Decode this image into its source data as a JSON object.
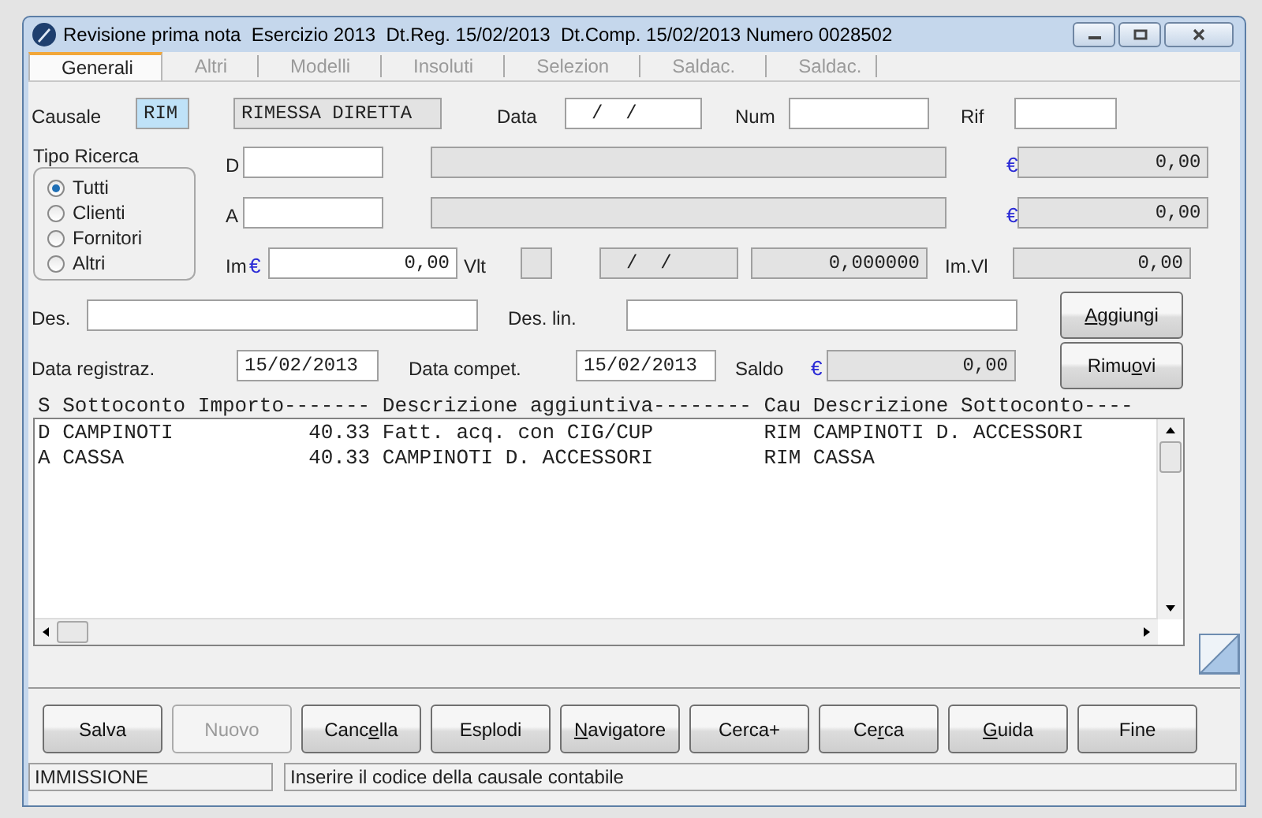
{
  "window": {
    "title": "Revisione prima nota  Esercizio 2013  Dt.Reg. 15/02/2013  Dt.Comp. 15/02/2013 Numero 0028502"
  },
  "tabs": [
    {
      "label": "Generali",
      "selected": true
    },
    {
      "label": "Altri",
      "selected": false
    },
    {
      "label": "Modelli",
      "selected": false
    },
    {
      "label": "Insoluti",
      "selected": false
    },
    {
      "label": "Selezion",
      "selected": false
    },
    {
      "label": "Saldac.",
      "selected": false
    },
    {
      "label": "Saldac.",
      "selected": false
    }
  ],
  "causale": {
    "label": "Causale",
    "code": "RIM",
    "description": "RIMESSA DIRETTA"
  },
  "data": {
    "label": "Data",
    "value": "/  /"
  },
  "num": {
    "label": "Num"
  },
  "rif": {
    "label": "Rif"
  },
  "tipo_ricerca": {
    "label": "Tipo Ricerca",
    "options": [
      {
        "label": "Tutti",
        "selected": true
      },
      {
        "label": "Clienti",
        "selected": false
      },
      {
        "label": "Fornitori",
        "selected": false
      },
      {
        "label": "Altri",
        "selected": false
      }
    ]
  },
  "conto_rows": [
    {
      "label": "D",
      "currency": "€",
      "amount": "0,00"
    },
    {
      "label": "A",
      "currency": "€",
      "amount": "0,00"
    }
  ],
  "importo": {
    "label": "Im",
    "currency": "€",
    "value": "0,00",
    "valuta_label": "Vlt",
    "date": "/  /",
    "cambio": "0,000000",
    "im_vl_label": "Im.Vl",
    "im_vl": "0,00"
  },
  "des": {
    "label": "Des."
  },
  "des_lin": {
    "label": "Des. lin."
  },
  "data_registraz": {
    "label": "Data registraz.",
    "value": "15/02/2013"
  },
  "data_compet": {
    "label": "Data compet.",
    "value": "15/02/2013"
  },
  "saldo": {
    "label": "Saldo",
    "currency": "€",
    "value": "0,00"
  },
  "side_buttons": [
    {
      "hotkey": "A",
      "text_after": "ggiungi"
    },
    {
      "text_before": "Rimu",
      "hotkey": "o",
      "text_after": "vi"
    }
  ],
  "table": {
    "columns": [
      "S",
      "Sottoconto",
      "Importo-------",
      "Descrizione aggiuntiva--------",
      "Cau",
      "Descrizione Sottoconto----"
    ],
    "rows": [
      [
        "D",
        "CAMPINOTI",
        "40.33",
        "Fatt. acq. con CIG/CUP",
        "RIM",
        "CAMPINOTI D. ACCESSORI"
      ],
      [
        "A",
        "CASSA",
        "40.33",
        "CAMPINOTI D. ACCESSORI",
        "RIM",
        "CASSA"
      ]
    ]
  },
  "buttons": [
    {
      "text_before": "Salva",
      "disabled": false
    },
    {
      "text_before": "Nuovo",
      "disabled": true
    },
    {
      "text_before": "Canc",
      "hotkey": "e",
      "text_after": "lla",
      "disabled": false
    },
    {
      "text_before": "Esplodi",
      "disabled": false
    },
    {
      "hotkey": "N",
      "text_after": "avigatore",
      "disabled": false
    },
    {
      "text_before": "Cerca+",
      "disabled": false
    },
    {
      "text_before": "Ce",
      "hotkey": "r",
      "text_after": "ca",
      "disabled": false
    },
    {
      "hotkey": "G",
      "text_after": "uida",
      "disabled": false
    },
    {
      "text_before": "Fine",
      "disabled": false
    }
  ],
  "status_bar": {
    "mode": "IMMISSIONE",
    "message": "Inserire il codice della causale contabile"
  }
}
